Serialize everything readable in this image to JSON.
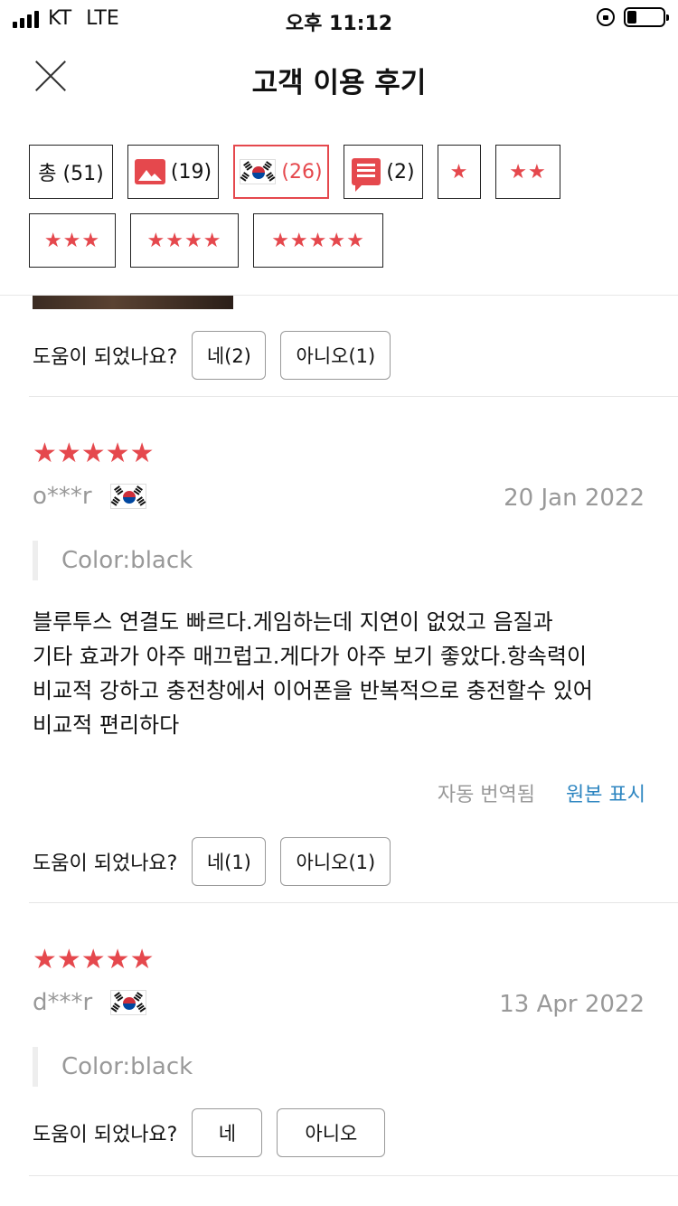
{
  "status_bar": {
    "carrier": "KT",
    "network": "LTE",
    "time": "오후 11:12"
  },
  "header": {
    "title": "고객 이용 후기"
  },
  "filters": {
    "all": "총 (51)",
    "photo": "(19)",
    "korea": "(26)",
    "comment": "(2)",
    "star1": "★",
    "star2": "★★",
    "star3": "★★★",
    "star4": "★★★★",
    "star5": "★★★★★"
  },
  "helpful_question": "도움이 되었나요?",
  "reviews": [
    {
      "helpful_yes": "네(2)",
      "helpful_no": "아니오(1)"
    },
    {
      "stars": "★★★★★",
      "rating": 5,
      "user": "o***r",
      "date": "20 Jan 2022",
      "variant": "Color:black",
      "text_lines": [
        "블루투스 연결도 빠르다.게임하는데 지연이 없었고 음질과",
        "기타 효과가 아주 매끄럽고.게다가 아주 보기 좋았다.항속력이",
        "비교적 강하고 충전창에서 이어폰을 반복적으로 충전할수 있어",
        "비교적 편리하다"
      ],
      "auto_translated": "자동 번역됨",
      "show_original": "원본 표시",
      "helpful_yes": "네(1)",
      "helpful_no": "아니오(1)"
    },
    {
      "stars": "★★★★★",
      "rating": 5,
      "user": "d***r",
      "date": "13 Apr 2022",
      "variant": "Color:black",
      "helpful_yes": "네",
      "helpful_no": "아니오"
    }
  ],
  "colors": {
    "accent": "#e5484d",
    "link": "#2e86c1",
    "muted": "#999999"
  }
}
